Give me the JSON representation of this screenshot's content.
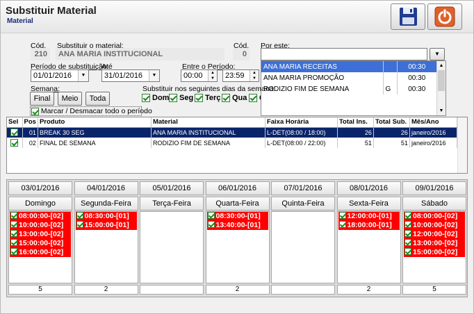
{
  "window": {
    "title": "Substituir Material",
    "subtitle": "Material"
  },
  "toolbar": {
    "save_icon": "floppy-disk-icon",
    "exit_icon": "power-icon"
  },
  "form": {
    "cod_label": "Cód.",
    "cod_value": "210",
    "substituir_label": "Substituir o material:",
    "substituir_value": "ANA MARIA INSTITUCIONAL",
    "cod2_label": "Cód.",
    "cod2_value": "0",
    "por_este_label": "Por este:",
    "por_este_value": "",
    "periodo_label": "Período de substituição:",
    "periodo_value": "01/01/2016",
    "ate_label": "Até",
    "ate_value": "31/01/2016",
    "entre_label": "Entre o Período:",
    "hora_inicio": "00:00",
    "hora_fim": "23:59",
    "semana_label": "Semana:",
    "btn_final": "Final",
    "btn_meio": "Meio",
    "btn_toda": "Toda",
    "dias_label": "Substituir nos seguintes dias da semana:",
    "dias": [
      "Dom",
      "Seg",
      "Terç",
      "Qua",
      "Q"
    ],
    "marcar_label": "Marcar / Desmacar todo o período"
  },
  "por_este_options": [
    {
      "name": "ANA MARIA  RECEITAS",
      "flag": "",
      "dur": "00:30",
      "selected": true
    },
    {
      "name": "ANA MARIA PROMOÇÃO",
      "flag": "",
      "dur": "00:30",
      "selected": false
    },
    {
      "name": "RODIZIO FIM DE SEMANA",
      "flag": "G",
      "dur": "00:30",
      "selected": false
    }
  ],
  "table": {
    "headers": [
      "Sel",
      "Pos",
      "Produto",
      "Material",
      "Faixa Horária",
      "Total Ins.",
      "Total Sub.",
      "Mês/Ano"
    ],
    "rows": [
      {
        "pos": "01",
        "produto": "BREAK 30 SEG",
        "material": "ANA MARIA INSTITUCIONAL",
        "faixa": "L-DET(08:00 / 18:00)",
        "ins": "26",
        "sub": "26",
        "mes": "janeiro/2016",
        "selected": true
      },
      {
        "pos": "02",
        "produto": "FINAL DE SEMANA",
        "material": "RODIZIO FIM DE SEMANA",
        "faixa": "L-DET(08:00 / 22:00)",
        "ins": "51",
        "sub": "51",
        "mes": "janeiro/2016",
        "selected": false
      }
    ]
  },
  "calendar": [
    {
      "date": "03/01/2016",
      "day": "Domingo",
      "slots": [
        "08:00:00-[02]",
        "10:00:00-[02]",
        "13:00:00-[02]",
        "15:00:00-[02]",
        "16:00:00-[02]"
      ],
      "count": "5"
    },
    {
      "date": "04/01/2016",
      "day": "Segunda-Feira",
      "slots": [
        "08:30:00-[01]",
        "15:00:00-[01]"
      ],
      "count": "2"
    },
    {
      "date": "05/01/2016",
      "day": "Terça-Feira",
      "slots": [],
      "count": ""
    },
    {
      "date": "06/01/2016",
      "day": "Quarta-Feira",
      "slots": [
        "08:30:00-[01]",
        "13:40:00-[01]"
      ],
      "count": "2"
    },
    {
      "date": "07/01/2016",
      "day": "Quinta-Feira",
      "slots": [],
      "count": ""
    },
    {
      "date": "08/01/2016",
      "day": "Sexta-Feira",
      "slots": [
        "12:00:00-[01]",
        "18:00:00-[01]"
      ],
      "count": "2"
    },
    {
      "date": "09/01/2016",
      "day": "Sábado",
      "slots": [
        "08:00:00-[02]",
        "10:00:00-[02]",
        "12:00:00-[02]",
        "13:00:00-[02]",
        "15:00:00-[02]"
      ],
      "count": "5"
    }
  ],
  "colors": {
    "slot_bg": "#ff0000",
    "selected_row": "#0a246a",
    "selected_option": "#3d6fd6",
    "subtitle": "#1a2a7a"
  }
}
